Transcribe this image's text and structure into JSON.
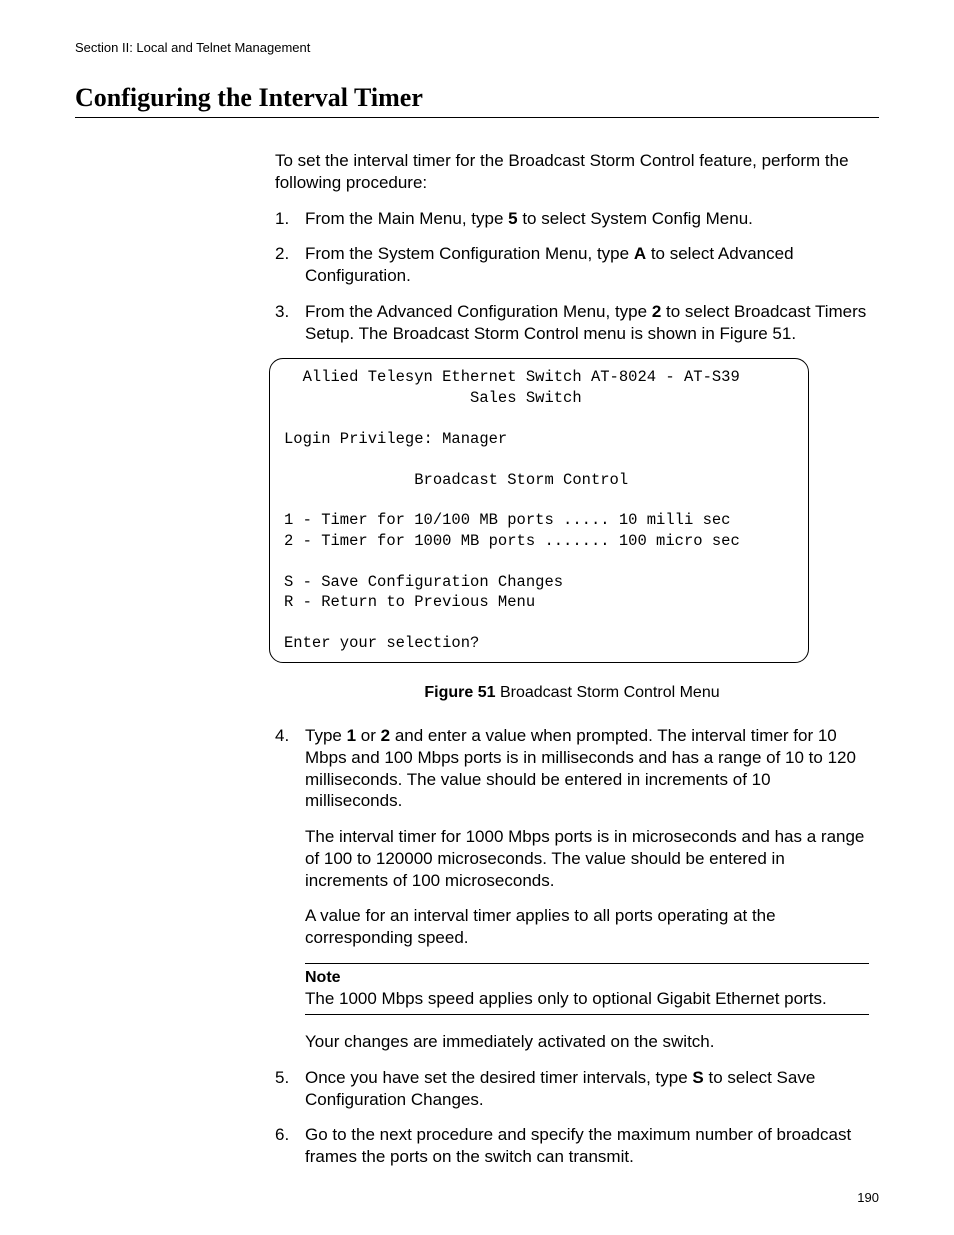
{
  "header": "Section II: Local and Telnet Management",
  "title": "Configuring the Interval Timer",
  "intro": "To set the interval timer for the Broadcast Storm Control feature, perform the following procedure:",
  "steps": {
    "s1": {
      "num": "1.",
      "a": "From the Main Menu, type ",
      "b": "5",
      "c": " to select System Config Menu."
    },
    "s2": {
      "num": "2.",
      "a": "From the System Configuration Menu, type ",
      "b": "A",
      "c": " to select Advanced Configuration."
    },
    "s3": {
      "num": "3.",
      "a": "From the Advanced Configuration Menu, type ",
      "b": "2",
      "c": " to select Broadcast Timers Setup. The Broadcast Storm Control menu is shown in Figure 51."
    },
    "s4": {
      "num": "4.",
      "a": "Type ",
      "b": "1",
      "c": " or ",
      "d": "2",
      "e": " and enter a value when prompted. The interval timer for 10 Mbps and 100 Mbps ports is in milliseconds and has a range of 10 to 120 milliseconds. The value should be entered in increments of 10 milliseconds.",
      "p2": "The interval timer for 1000 Mbps ports is in microseconds and has a range of 100 to 120000 microseconds. The value should be entered in increments of 100 microseconds.",
      "p3": "A value for an interval timer applies to all ports operating at the corresponding speed.",
      "note_label": "Note",
      "note_text": "The 1000 Mbps speed applies only to optional Gigabit Ethernet ports.",
      "p4": "Your changes are immediately activated on the switch."
    },
    "s5": {
      "num": "5.",
      "a": "Once you have set the desired timer intervals, type ",
      "b": "S",
      "c": " to select Save Configuration Changes."
    },
    "s6": {
      "num": "6.",
      "a": "Go to the next procedure and specify the maximum number of broadcast frames the ports on the switch can transmit."
    }
  },
  "terminal": {
    "l1": "  Allied Telesyn Ethernet Switch AT-8024 - AT-S39",
    "l2": "                    Sales Switch",
    "l3": "Login Privilege: Manager",
    "l4": "              Broadcast Storm Control",
    "l5": "1 - Timer for 10/100 MB ports ..... 10 milli sec",
    "l6": "2 - Timer for 1000 MB ports ....... 100 micro sec",
    "l7": "S - Save Configuration Changes",
    "l8": "R - Return to Previous Menu",
    "l9": "Enter your selection?"
  },
  "figure": {
    "label": "Figure 51",
    "caption": "  Broadcast Storm Control Menu"
  },
  "page_number": "190"
}
